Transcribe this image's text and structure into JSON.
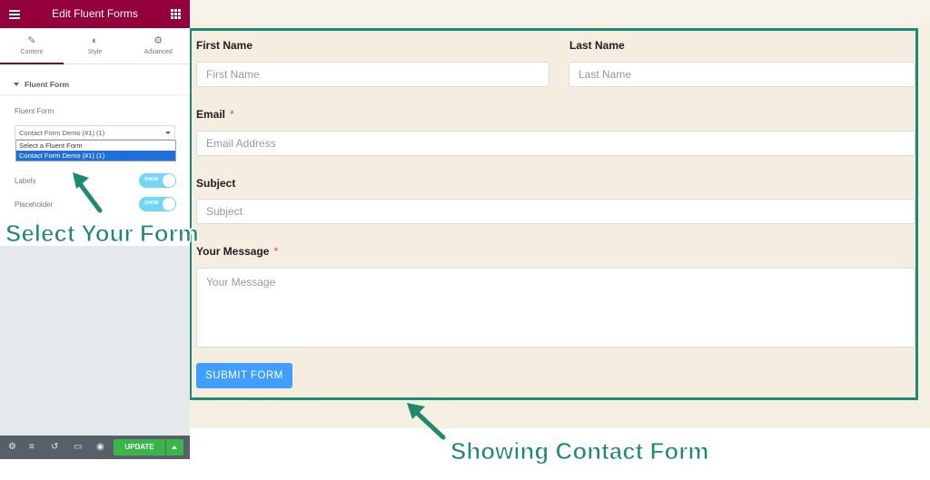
{
  "sidebar": {
    "title": "Edit Fluent Forms",
    "tabs": [
      {
        "label": "Content",
        "icon": "pencil-icon"
      },
      {
        "label": "Style",
        "icon": "contrast-icon"
      },
      {
        "label": "Advanced",
        "icon": "gear-icon"
      }
    ],
    "section_title": "Fluent Form",
    "field_label": "Fluent Form",
    "select_value": "Contact Form Demo (#1) (1)",
    "dropdown_options": [
      "Select a Fluent Form",
      "Contact Form Demo (#1) (1)"
    ],
    "toggles": [
      {
        "label": "Labels",
        "state": "SHOW"
      },
      {
        "label": "Placeholder",
        "state": "SHOW"
      }
    ],
    "footer": {
      "update_label": "UPDATE"
    }
  },
  "form": {
    "first_name_label": "First Name",
    "first_name_placeholder": "First Name",
    "last_name_label": "Last Name",
    "last_name_placeholder": "Last Name",
    "email_label": "Email",
    "email_placeholder": "Email Address",
    "subject_label": "Subject",
    "subject_placeholder": "Subject",
    "message_label": "Your Message",
    "message_placeholder": "Your Message",
    "required_mark": "*",
    "submit_label": "SUBMIT FORM"
  },
  "annotations": {
    "select_form": "Select Your Form",
    "showing_form": "Showing Contact Form"
  },
  "colors": {
    "brand": "#93003c",
    "frame": "#1c8a72",
    "submit": "#409eff",
    "update": "#39b54a"
  }
}
